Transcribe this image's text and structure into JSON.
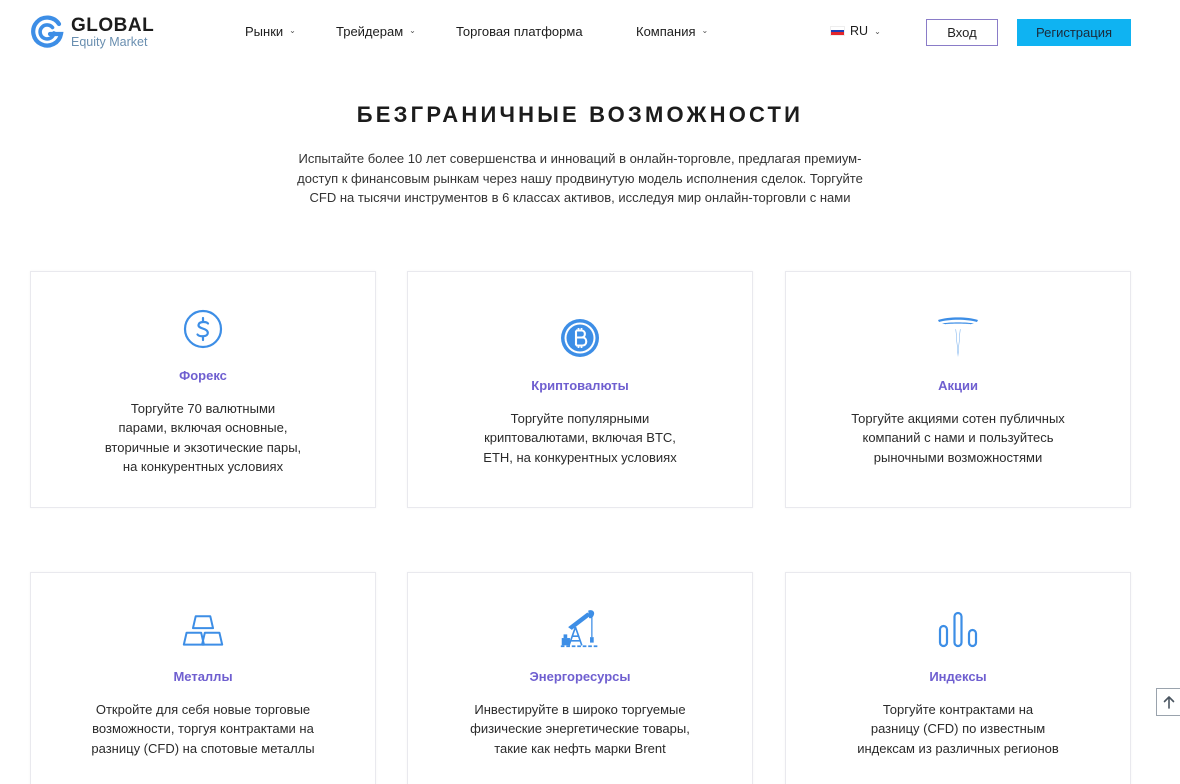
{
  "header": {
    "logo_name": "GLOBAL",
    "logo_sub": "Equity Market",
    "nav": [
      {
        "label": "Рынки",
        "has_dropdown": true
      },
      {
        "label": "Трейдерам",
        "has_dropdown": true
      },
      {
        "label": "Торговая платформа",
        "has_dropdown": false
      },
      {
        "label": "Компания",
        "has_dropdown": true
      }
    ],
    "lang": "RU",
    "login_label": "Вход",
    "register_label": "Регистрация"
  },
  "hero": {
    "title": "БЕЗГРАНИЧНЫЕ ВОЗМОЖНОСТИ",
    "desc_lines": [
      "Испытайте более 10 лет совершенства и инноваций в онлайн-торговле, предлагая премиум-",
      "доступ к финансовым рынкам через нашу продвинутую модель исполнения сделок. Торгуйте",
      "CFD на тысячи инструментов в 6 классах активов, исследуя мир онлайн-торговли с нами"
    ]
  },
  "cards": [
    {
      "title": "Форекс",
      "icon": "dollar-coin-icon",
      "lines": [
        "Торгуйте 70 валютными",
        "парами, включая основные,",
        "вторичные и экзотические пары,",
        "на конкурентных условиях"
      ]
    },
    {
      "title": "Криптовалюты",
      "icon": "bitcoin-icon",
      "lines": [
        "Торгуйте популярными",
        "криптовалютами, включая BTC,",
        "ETH, на конкурентных условиях"
      ]
    },
    {
      "title": "Акции",
      "icon": "tesla-logo-icon",
      "lines": [
        "Торгуйте акциями сотен публичных",
        "компаний с нами и пользуйтесь",
        "рыночными возможностями"
      ]
    },
    {
      "title": "Металлы",
      "icon": "gold-bars-icon",
      "lines": [
        "Откройте для себя новые торговые",
        "возможности, торгуя контрактами на",
        "разницу (CFD) на спотовые металлы"
      ]
    },
    {
      "title": "Энергоресурсы",
      "icon": "oil-pump-icon",
      "lines": [
        "Инвестируйте в широко торгуемые",
        "физические энергетические товары,",
        "такие как нефть марки Brent"
      ]
    },
    {
      "title": "Индексы",
      "icon": "bar-chart-icon",
      "lines": [
        "Торгуйте контрактами на",
        "разницу (CFD) по известным",
        "индексам из различных регионов"
      ]
    }
  ],
  "colors": {
    "accent_purple": "#6f5fd0",
    "icon_blue": "#3d8ee6",
    "register_bg": "#0fb3f2",
    "login_border": "#8a7cc8"
  }
}
